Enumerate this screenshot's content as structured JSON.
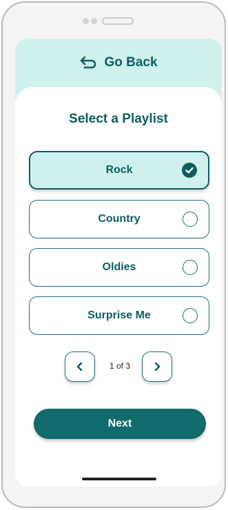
{
  "header": {
    "back_label": "Go Back"
  },
  "main": {
    "title": "Select a Playlist",
    "options": [
      {
        "label": "Rock",
        "selected": true
      },
      {
        "label": "Country",
        "selected": false
      },
      {
        "label": "Oldies",
        "selected": false
      },
      {
        "label": "Surprise Me",
        "selected": false
      }
    ],
    "pagination": {
      "text": "1 of 3",
      "prev_icon": "chevron-left-icon",
      "next_icon": "chevron-right-icon"
    },
    "next_label": "Next"
  },
  "colors": {
    "primary": "#0d5d60",
    "accent_bg": "#cff1ee",
    "button": "#116a6c"
  }
}
